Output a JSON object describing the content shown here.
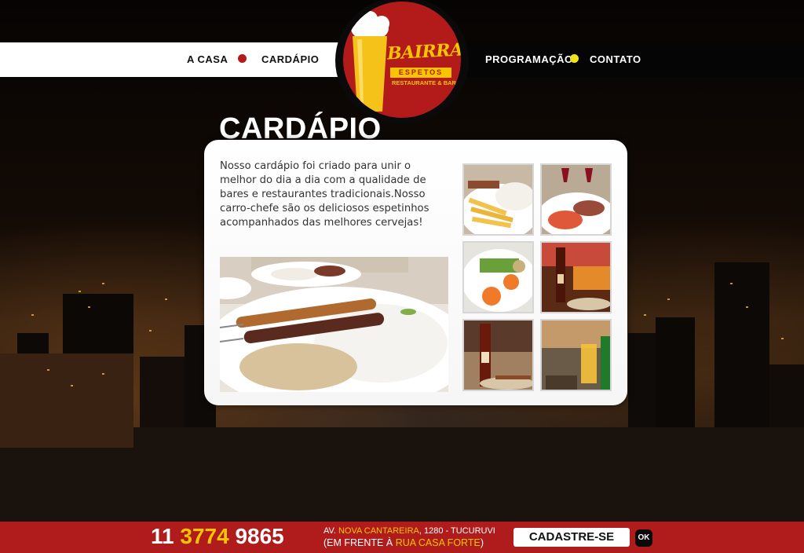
{
  "nav": {
    "left": [
      {
        "label": "A CASA"
      },
      {
        "label": "CARDÁPIO"
      }
    ],
    "right": [
      {
        "label": "PROGRAMAÇÃO"
      },
      {
        "label": "CONTATO"
      }
    ],
    "dot_colors": {
      "left": "#b31b1b",
      "right": "#f2e21a"
    }
  },
  "logo": {
    "name": "BAIRRADA",
    "espetos": "ESPETOS",
    "sub": "RESTAURANTE & BAR"
  },
  "page": {
    "title": "CARDÁPIO",
    "intro": "Nosso cardápio foi criado para unir o melhor do dia a dia com a qualidade de bares e restaurantes tradicionais.Nosso carro-chefe são os deliciosos espetinhos acompanhados das melhores cervejas!"
  },
  "photos": {
    "main": "espetinhos-arroz-farofa-photo",
    "thumbnails": [
      "fries-rice-plate-thumb",
      "wine-glasses-table-thumb",
      "grilled-vegetables-thumb",
      "bar-beer-bottle-thumb",
      "beer-bottle-skewers-thumb",
      "beer-glass-bar-thumb"
    ]
  },
  "footer": {
    "phone_area": "11",
    "phone_part1": "3774",
    "phone_part2": "9865",
    "addr_prefix": "AV.",
    "addr_street": "NOVA CANTAREIRA",
    "addr_suffix": ", 1280 - TUCURUVI",
    "addr2_prefix": "(EM FRENTE À",
    "addr2_highlight": "RUA CASA FORTE",
    "addr2_suffix": ")",
    "cadastre_label": "CADASTRE-SE",
    "ok_label": "OK"
  },
  "colors": {
    "brand_red": "#b01c1c",
    "brand_yellow": "#f6c400"
  }
}
